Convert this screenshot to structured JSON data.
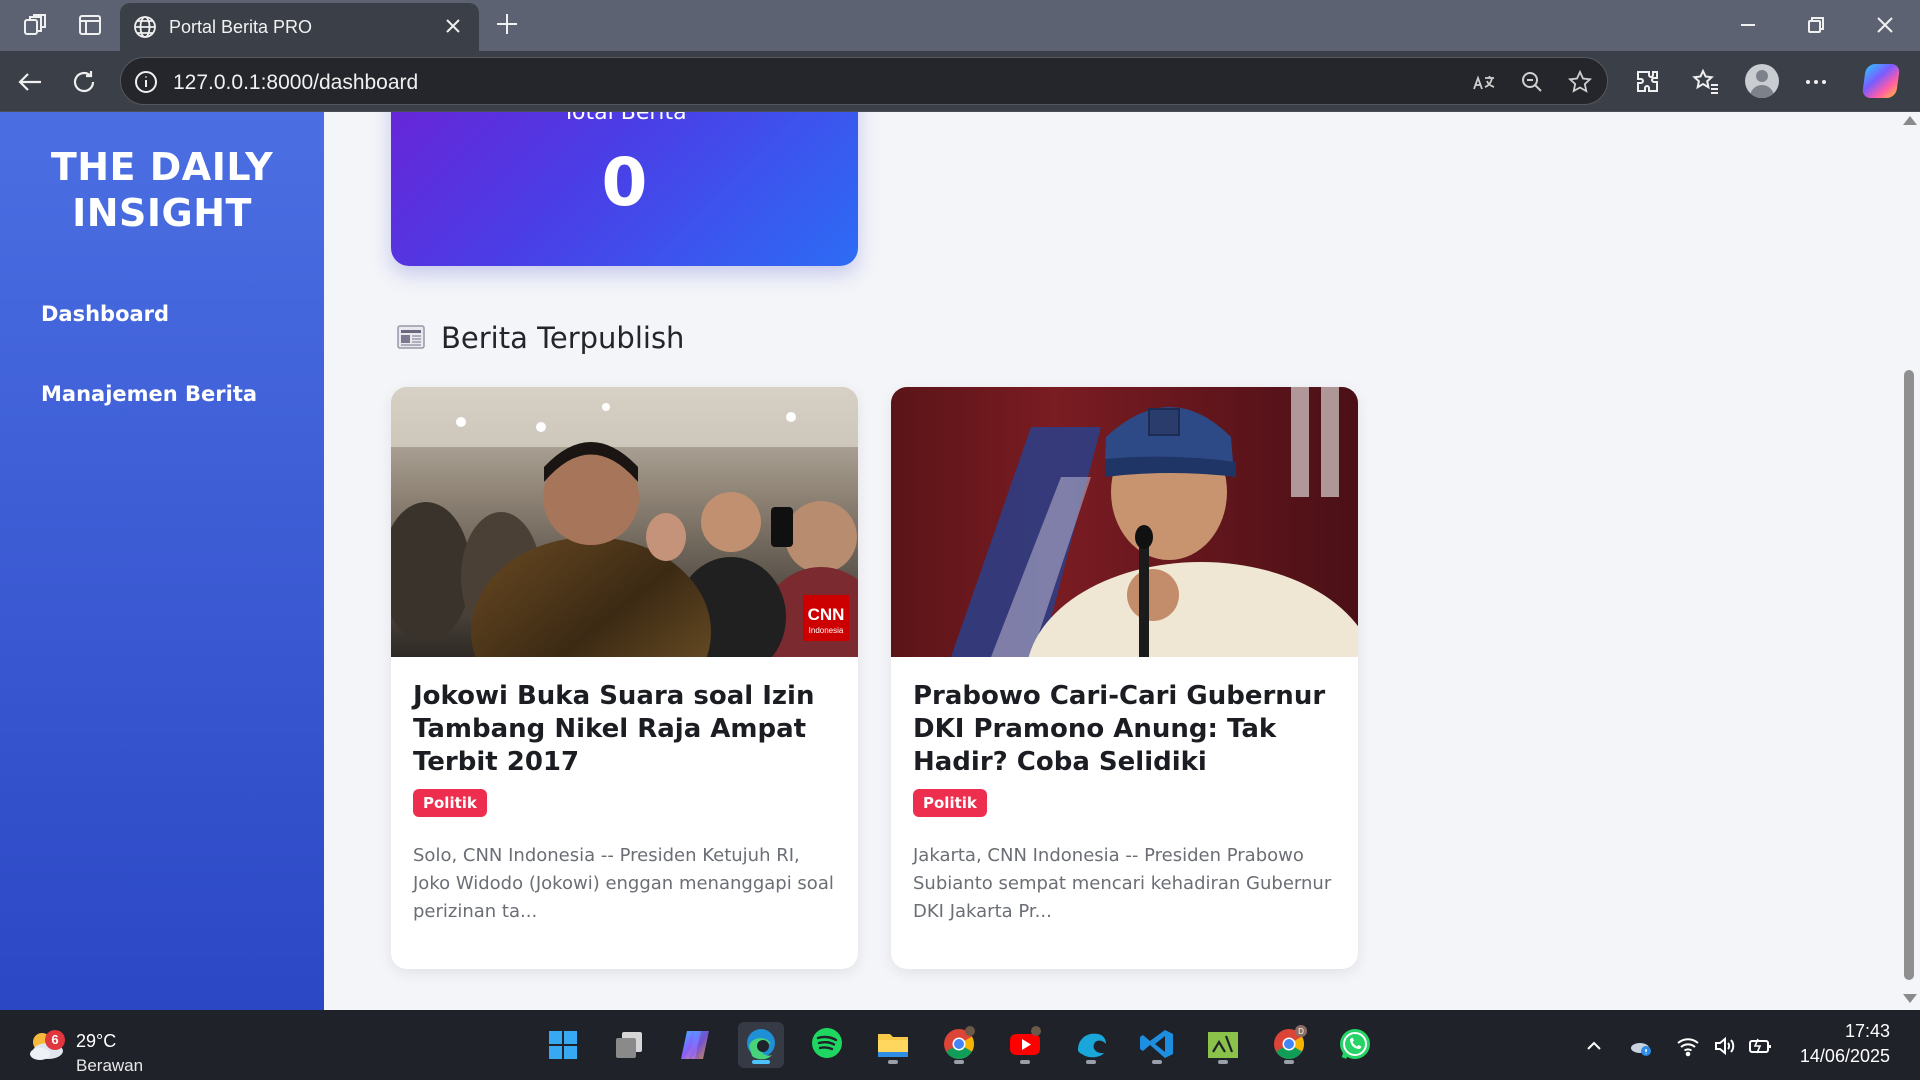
{
  "browser": {
    "tab_title": "Portal Berita PRO",
    "url": "127.0.0.1:8000/dashboard"
  },
  "sidebar": {
    "brand_line1": "THE DAILY",
    "brand_line2": "INSIGHT",
    "items": [
      {
        "label": "Dashboard"
      },
      {
        "label": "Manajemen Berita"
      }
    ]
  },
  "stats": {
    "label": "Total Berita",
    "value": "0"
  },
  "section": {
    "title": "Berita Terpublish",
    "icon": "newspaper-icon"
  },
  "articles": [
    {
      "title": "Jokowi Buka Suara soal Izin Tambang Nikel Raja Ampat Terbit 2017",
      "category": "Politik",
      "excerpt": "Solo, CNN Indonesia -- Presiden Ketujuh RI, Joko Widodo (Jokowi) enggan menanggapi soal perizinan ta...",
      "image_watermark": "CNN",
      "image_watermark_sub": "Indonesia"
    },
    {
      "title": "Prabowo Cari-Cari Gubernur DKI Pramono Anung: Tak Hadir? Coba Selidiki",
      "category": "Politik",
      "excerpt": "Jakarta, CNN Indonesia -- Presiden Prabowo Subianto sempat mencari kehadiran Gubernur DKI Jakarta Pr..."
    }
  ],
  "taskbar": {
    "weather_badge": "6",
    "weather_temp": "29°C",
    "weather_desc": "Berawan",
    "time": "17:43",
    "date": "14/06/2025",
    "apps": [
      "windows-start-icon",
      "task-view-icon",
      "copilot-icon",
      "edge-icon",
      "spotify-icon",
      "file-explorer-icon",
      "chrome-icon",
      "youtube-icon",
      "edge-dev-icon",
      "vscode-icon",
      "terminal-icon",
      "chrome-profile-icon",
      "whatsapp-icon"
    ]
  },
  "colors": {
    "sidebar_top": "#4b6fe3",
    "sidebar_bottom": "#2c47c4",
    "badge": "#ee2e4f",
    "stat_gradient_start": "#6a23d6",
    "stat_gradient_end": "#2d6cf5"
  }
}
